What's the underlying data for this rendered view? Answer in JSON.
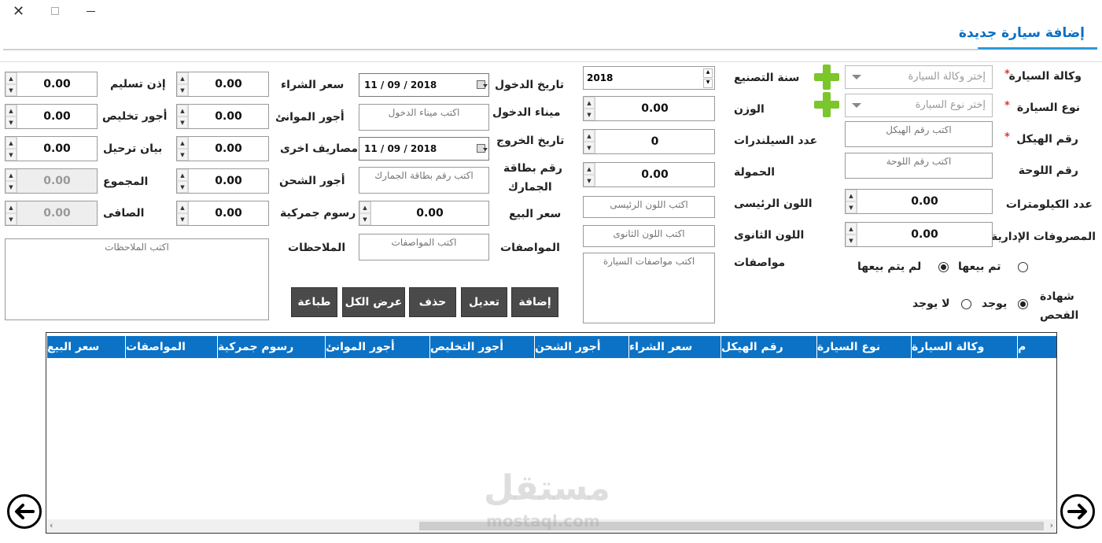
{
  "window": {
    "title": "إضافة سيارة جديدة"
  },
  "fields": {
    "agency": {
      "label": "وكالة السيارة",
      "placeholder": "إختر وكالة السيارة"
    },
    "type": {
      "label": "نوع السيارة",
      "placeholder": "إختر نوع السيارة"
    },
    "chassis": {
      "label": "رقم الهيكل",
      "placeholder": "اكتب رقم الهيكل"
    },
    "plate": {
      "label": "رقم اللوحة",
      "placeholder": "اكتب رقم اللوحة"
    },
    "km": {
      "label": "عدد الكيلومترات",
      "value": "0.00"
    },
    "admin_exp": {
      "label": "المصروفات الإدارية",
      "value": "0.00"
    },
    "year": {
      "label": "سنة التصنيع",
      "value": "2018"
    },
    "weight": {
      "label": "الوزن",
      "value": "0.00"
    },
    "cylinders": {
      "label": "عدد السيلندرات",
      "value": "0"
    },
    "load": {
      "label": "الحمولة",
      "value": "0.00"
    },
    "main_color": {
      "label": "اللون الرئيسى",
      "placeholder": "اكتب اللون الرئيسى"
    },
    "second_color": {
      "label": "اللون الثانوى",
      "placeholder": "اكتب اللون الثانوى"
    },
    "specs_car": {
      "label": "مواصفات",
      "placeholder": "اكتب مواصفات السيارة"
    },
    "entry_date": {
      "label": "تاريخ الدخول",
      "value": "11 / 09 / 2018"
    },
    "entry_port": {
      "label": "ميناء الدخول",
      "placeholder": "اكتب ميناء الدخول"
    },
    "exit_date": {
      "label": "تاريخ الخروج",
      "value": "11 / 09 / 2018"
    },
    "customs_card": {
      "label1": "رقم بطاقة",
      "label2": "الجمارك",
      "placeholder": "اكتب رقم  بطاقة الجمارك"
    },
    "sale_price": {
      "label": "سعر البيع",
      "value": "0.00"
    },
    "specs": {
      "label": "المواصفات",
      "placeholder": "اكتب المواصفات"
    },
    "purchase_price": {
      "label": "سعر الشراء",
      "value": "0.00"
    },
    "port_fees": {
      "label": "أجور الموانئ",
      "value": "0.00"
    },
    "other_exp": {
      "label": "مصاريف اخرى",
      "value": "0.00"
    },
    "shipping": {
      "label": "أجور الشحن",
      "value": "0.00"
    },
    "customs_fees": {
      "label": "رسوم جمركية",
      "value": "0.00"
    },
    "notes": {
      "label": "الملاحظات",
      "placeholder": "اكتب الملاحظات"
    },
    "delivery": {
      "label": "إذن تسليم",
      "value": "0.00"
    },
    "clearance": {
      "label": "أجور تخليص",
      "value": "0.00"
    },
    "transfer": {
      "label": "بيان ترحيل",
      "value": "0.00"
    },
    "total": {
      "label": "المجموع",
      "value": "0.00"
    },
    "net": {
      "label": "الصافى",
      "value": "0.00"
    }
  },
  "sold": {
    "opt1": "تم بيعها",
    "opt2": "لم يتم بيعها"
  },
  "inspection": {
    "label1": "شهادة",
    "label2": "الفحص",
    "opt1": "يوجد",
    "opt2": "لا يوجد"
  },
  "buttons": {
    "add": "إضافة",
    "edit": "تعديل",
    "delete": "حذف",
    "show_all": "عرض الكل",
    "print": "طباعة"
  },
  "table": {
    "columns": [
      "م",
      "وكالة السيارة",
      "نوع السيارة",
      "رقم الهيكل",
      "سعر الشراء",
      "أجور الشحن",
      "أجور التخليص",
      "أجور الموانئ",
      "رسوم جمركية",
      "المواصفات",
      "سعر البيع"
    ]
  },
  "required_mark": "*",
  "watermark": {
    "text1": "مستقل",
    "text2": "mostaql.com"
  }
}
